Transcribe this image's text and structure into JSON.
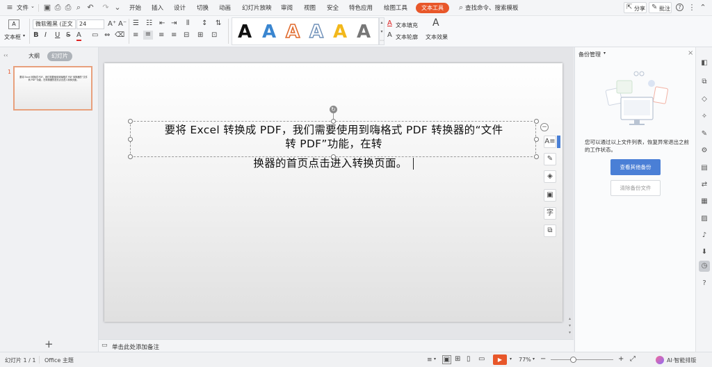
{
  "menubar": {
    "file_label": "文件",
    "tabs": [
      "开始",
      "插入",
      "设计",
      "切换",
      "动画",
      "幻灯片放映",
      "审阅",
      "视图",
      "安全",
      "特色应用",
      "绘图工具"
    ],
    "active_tab": "文本工具",
    "search_label": "查找命令、搜索模板",
    "share_label": "分享",
    "annotate_label": "批注"
  },
  "ribbon": {
    "textbox_label": "文本框",
    "font_name": "微软雅黑 (正文",
    "font_size": "24",
    "bold": "B",
    "italic": "I",
    "underline": "U",
    "strike": "S",
    "fill_label": "文本填充",
    "outline_label": "文本轮廓",
    "effect_label": "文本效果",
    "art_letter": "A",
    "art_colors": [
      "#111111",
      "#3a86d0",
      "#e06a2c",
      "#6d8fb8",
      "#f2b81c",
      "#777777"
    ]
  },
  "left_panel": {
    "tab_outline": "大纲",
    "tab_slides": "幻灯片",
    "slide_number": "1",
    "thumb_text": "要将 Excel 转换成 PDF，我们需要使用到嗨格式 PDF 转换器的“文件转 PDF”功能，在转换器的首页点击进入转换页面。"
  },
  "slide": {
    "line1": "要将 Excel 转换成 PDF，我们需要使用到嗨格式 PDF 转换器的“文件",
    "line2": "转 PDF”功能，在转",
    "line3": "换器的首页点击进入转换页面。"
  },
  "notes_placeholder": "单击此处添加备注",
  "backup": {
    "title": "备份管理",
    "description": "您可以通过以上文件列表，恢复异常退出之前的工作状态。",
    "view_button": "查看其他备份",
    "clear_button": "清除备份文件"
  },
  "status": {
    "slide_info": "幻灯片 1 / 1",
    "theme": "Office 主题",
    "zoom": "77%",
    "ai_label": "AI·智能排版"
  },
  "colors": {
    "accent": "#e8572a",
    "primary_button": "#4a7fd6"
  }
}
